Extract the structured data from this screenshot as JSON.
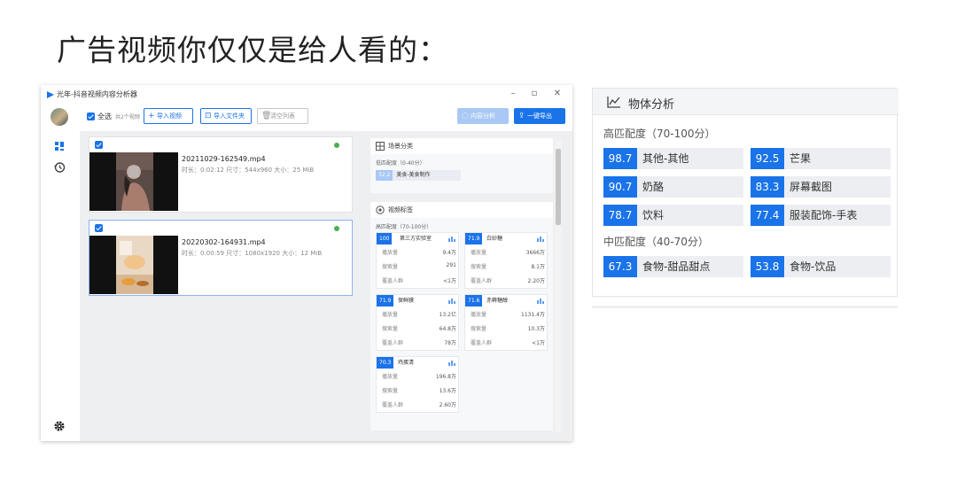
{
  "slide": {
    "title": "广告视频你仅仅是给人看的："
  },
  "window": {
    "title": "光年-抖音视频内容分析器",
    "controls": {
      "minimize": "–",
      "maximize": "▫",
      "close": "✕"
    }
  },
  "toolbar": {
    "select_all": "全选",
    "count": "共2个视频",
    "import_video": "导入视频",
    "import_folder": "导入文件夹",
    "clear_list": "清空列表",
    "analyze": "内容分析",
    "export": "一键导出"
  },
  "videos": [
    {
      "filename": "20211029-162549.mp4",
      "meta": "时长：0:02:12   尺寸：544x960   大小：25 MiB"
    },
    {
      "filename": "20220302-164931.mp4",
      "meta": "时长：0:00:59   尺寸：1080x1920   大小：12 MiB"
    }
  ],
  "scene": {
    "header": "场景分类",
    "level": "低匹配度（0-40分）",
    "items": [
      {
        "score": "32.2",
        "label": "美食-美食制作"
      }
    ]
  },
  "tags": {
    "header": "视频标签",
    "level": "高匹配度（70-100分）",
    "row_labels": {
      "plays": "播放量",
      "searches": "搜索量",
      "audience": "覆盖人群"
    },
    "cards": [
      {
        "score": "100",
        "name": "第三方实验室",
        "plays": "9.4万",
        "searches": "291",
        "audience": "<1万"
      },
      {
        "score": "71.9",
        "name": "白砂糖",
        "plays": "3666万",
        "searches": "8.1万",
        "audience": "2.20万"
      },
      {
        "score": "71.9",
        "name": "保鲜膜",
        "plays": "13.2亿",
        "searches": "64.8万",
        "audience": "78万"
      },
      {
        "score": "71.6",
        "name": "赤藓糖醇",
        "plays": "1131.4万",
        "searches": "10.3万",
        "audience": "<1万"
      },
      {
        "score": "70.3",
        "name": "鸡蛋清",
        "plays": "196.8万",
        "searches": "13.6万",
        "audience": "2.60万"
      }
    ]
  },
  "objects": {
    "header": "物体分析",
    "high_level": "高匹配度（70-100分）",
    "mid_level": "中匹配度（40-70分）",
    "high": [
      {
        "score": "98.7",
        "name": "其他-其他"
      },
      {
        "score": "92.5",
        "name": "芒果"
      },
      {
        "score": "90.7",
        "name": "奶酪"
      },
      {
        "score": "83.3",
        "name": "屏幕截图"
      },
      {
        "score": "78.7",
        "name": "饮料"
      },
      {
        "score": "77.4",
        "name": "服装配饰-手表"
      }
    ],
    "mid": [
      {
        "score": "67.3",
        "name": "食物-甜品甜点"
      },
      {
        "score": "53.8",
        "name": "食物-饮品"
      }
    ]
  },
  "colors": {
    "accent": "#1a73e8",
    "status_ok": "#4caf50"
  }
}
